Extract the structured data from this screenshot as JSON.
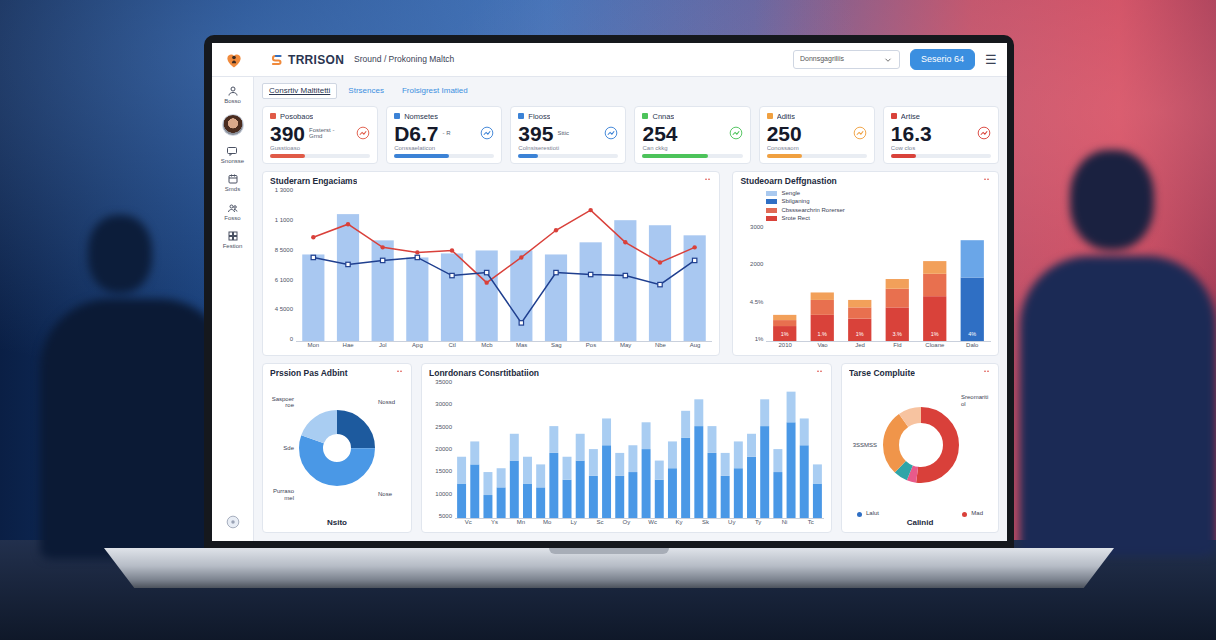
{
  "brand": {
    "name": "TRRISON",
    "breadcrumb": "Sround / Prokoning Maltch"
  },
  "toolbar": {
    "dropdown": "Donnsgagriliis",
    "button": "Seserio 64",
    "menu": "☰"
  },
  "sidebar": {
    "items": [
      {
        "label": "Bosso"
      },
      {
        "label": "Snonsse"
      },
      {
        "label": "Smds"
      },
      {
        "label": "Fosso"
      },
      {
        "label": "Festion"
      }
    ]
  },
  "tabs": [
    {
      "label": "Consrtiv Maltitetti",
      "selected": true
    },
    {
      "label": "Strsences",
      "selected": false
    },
    {
      "label": "Frolsigrest Imatied",
      "selected": false
    }
  ],
  "kpis": [
    {
      "label": "Posobaos",
      "value": "390",
      "note": "Fosterst - Grnd",
      "sub": "Gusstioaso",
      "level": 0.35,
      "color": "#e05a47"
    },
    {
      "label": "Nomsetes",
      "value": "D6.7",
      "note": "- R",
      "sub": "Conssaelaticon",
      "level": 0.55,
      "color": "#3b82d6"
    },
    {
      "label": "Flooss",
      "value": "395",
      "note": "Sttic",
      "sub": "Colnsiserestioti",
      "level": 0.2,
      "color": "#3b82d6"
    },
    {
      "label": "Cnnas",
      "value": "254",
      "sub": "Can ckkg",
      "level": 0.65,
      "color": "#4cc35a"
    },
    {
      "label": "Aditis",
      "value": "250",
      "sub": "Conossaom",
      "level": 0.35,
      "color": "#f0a040"
    },
    {
      "label": "Artise",
      "value": "16.3",
      "sub": "Cow clos",
      "level": 0.25,
      "color": "#d9423a"
    }
  ],
  "charts": {
    "engagement": {
      "title": "Studerarn Engaciams",
      "y_max": 13000,
      "y_ticks": [
        "1 3000",
        "1 1000",
        "8 5000",
        "6 1000",
        "4 5000",
        "0"
      ],
      "x_labels": [
        "Mon",
        "Hae",
        "Jol",
        "Apg",
        "Ctl",
        "Mcb",
        "Mas",
        "Sag",
        "Pos",
        "May",
        "Nbe",
        "Aug"
      ],
      "bars": [
        7550,
        11070,
        8780,
        7290,
        7640,
        7900,
        7900,
        7550,
        8610,
        10540,
        10100,
        9220
      ],
      "line_red": [
        9050,
        10190,
        8170,
        7730,
        7900,
        5090,
        7290,
        9660,
        11420,
        8610,
        6850,
        8170
      ],
      "line_blue": [
        7290,
        6680,
        7030,
        7290,
        5710,
        5970,
        1580,
        5970,
        5800,
        5710,
        4920,
        7030
      ]
    },
    "deffgnastion": {
      "title": "Studeoarn Deffgnastion",
      "y_max": 150,
      "y_ticks": [
        "3000",
        "2000",
        "4.5%",
        "1%"
      ],
      "x_labels": [
        "2010",
        "Vao",
        "Jed",
        "Fld",
        "Cloane",
        "Dalo"
      ],
      "legend": [
        {
          "label": "Sengle",
          "color": "#a9c9ef"
        },
        {
          "label": "Sbilganing",
          "color": "#2f6fc4"
        },
        {
          "label": "Cbsssearchrin Rorerser",
          "color": "#e06a55"
        },
        {
          "label": "Srote Rect",
          "color": "#d9423a"
        }
      ],
      "bar_labels": [
        "1%",
        "1.%",
        "1%",
        "3.%",
        "1%",
        "4%"
      ],
      "series": [
        {
          "color": "#d9423a",
          "values": [
            20,
            35,
            30,
            45,
            60,
            0
          ]
        },
        {
          "color": "#e8704f",
          "values": [
            8,
            20,
            15,
            25,
            30,
            0
          ]
        },
        {
          "color": "#f2a05a",
          "values": [
            7,
            10,
            10,
            13,
            17,
            0
          ]
        },
        {
          "color": "#2f6fc4",
          "values": [
            0,
            0,
            0,
            0,
            0,
            85
          ]
        },
        {
          "color": "#6aa6e8",
          "values": [
            0,
            0,
            0,
            0,
            0,
            50
          ]
        }
      ]
    },
    "pass": {
      "title": "Prssion Pas Adbint",
      "footer": "Nsito",
      "labels": [
        "Saspoerroe",
        "Sde",
        "Nossd",
        "Purrasomel",
        "Nose"
      ],
      "slices": [
        {
          "value": 25,
          "color": "#1d5a9e"
        },
        {
          "value": 55,
          "color": "#4a98e6"
        },
        {
          "value": 20,
          "color": "#a9cdf2"
        }
      ]
    },
    "contribution": {
      "title": "Lonrdonars Consrtitbatiion",
      "y_max": 35000,
      "y_ticks": [
        "35000",
        "30000",
        "25000",
        "20000",
        "15000",
        "10000",
        "5000"
      ],
      "x_labels": [
        "Vc",
        "Ys",
        "Mn",
        "Mo",
        "Ly",
        "Sc",
        "Oy",
        "Wc",
        "Ky",
        "Sk",
        "Uy",
        "Ty",
        "Ni",
        "Tc"
      ],
      "series": [
        {
          "color": "#4a98e6",
          "values": [
            9000,
            14000,
            6000,
            8000,
            15000,
            9000,
            8000,
            17000,
            10000,
            15000,
            11000,
            19000,
            11000,
            12000,
            18000,
            10000,
            13000,
            21000,
            24000,
            17000,
            11000,
            13000,
            16000,
            24000,
            12000,
            25000,
            19000,
            9000
          ]
        },
        {
          "color": "#a9cdf2",
          "values": [
            7000,
            6000,
            6000,
            5000,
            7000,
            7000,
            6000,
            7000,
            6000,
            7000,
            7000,
            7000,
            6000,
            7000,
            7000,
            5000,
            7000,
            7000,
            7000,
            7000,
            6000,
            7000,
            6000,
            7000,
            6000,
            8000,
            7000,
            5000
          ]
        }
      ]
    },
    "completion": {
      "title": "Tarse Compluite",
      "footer": "Calinid",
      "labels": [
        "Sreomaritiol",
        "3SSMSS"
      ],
      "legend": [
        {
          "label": "Lalut",
          "color": "#2f6fc4"
        },
        {
          "label": "Mad",
          "color": "#d9403a"
        }
      ],
      "slices": [
        {
          "value": 52,
          "color": "#d9403a"
        },
        {
          "value": 4,
          "color": "#e85a8a"
        },
        {
          "value": 6,
          "color": "#2fa5a8"
        },
        {
          "value": 28,
          "color": "#f0954a"
        },
        {
          "value": 10,
          "color": "#f7c3a0"
        }
      ]
    }
  }
}
